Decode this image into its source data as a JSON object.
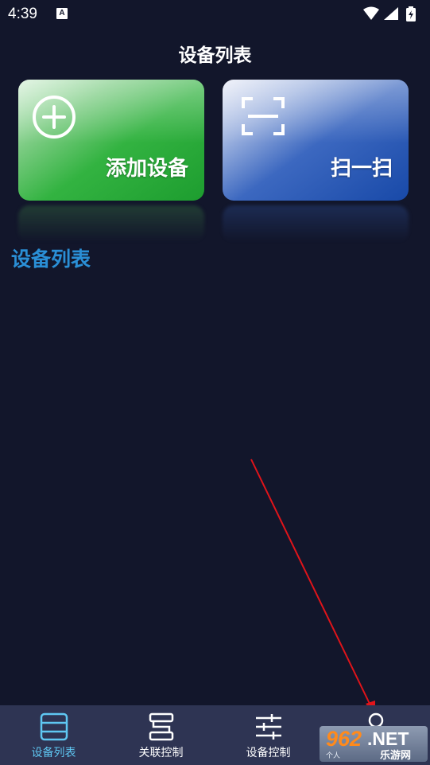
{
  "status_bar": {
    "time": "4:39",
    "notification_glyph": "A"
  },
  "header": {
    "title": "设备列表"
  },
  "cards": {
    "add": {
      "label": "添加设备",
      "icon": "plus-circle-icon",
      "color": "#22a733"
    },
    "scan": {
      "label": "扫一扫",
      "icon": "scan-frame-icon",
      "color": "#1a4aa6"
    }
  },
  "section": {
    "title": "设备列表",
    "color": "#2a8fd6"
  },
  "tabs": [
    {
      "label": "设备列表",
      "icon": "device-list-icon",
      "active": true
    },
    {
      "label": "关联控制",
      "icon": "linked-control-icon",
      "active": false
    },
    {
      "label": "设备控制",
      "icon": "sliders-icon",
      "active": false
    },
    {
      "label": "",
      "icon": "profile-icon",
      "active": false
    }
  ],
  "watermark": {
    "number": "962",
    "domain": ".NET",
    "site_name": "乐游网",
    "small_text": "个人"
  },
  "colors": {
    "background": "#12162b",
    "tabbar": "#2e3453",
    "active_tab": "#5fc7f2",
    "annotation_arrow": "#e0141a"
  }
}
